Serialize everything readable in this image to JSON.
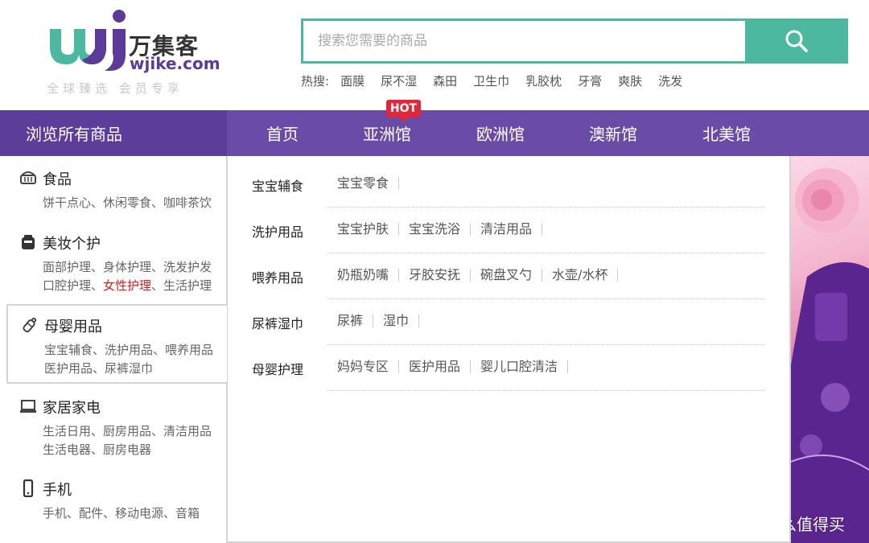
{
  "logo": {
    "name_cn": "万集客",
    "domain": "wjike.com",
    "slogan": "全球臻选 会员专享"
  },
  "search": {
    "placeholder": "搜索您需要的商品",
    "value": ""
  },
  "hot": {
    "label": "热搜:",
    "words": [
      "面膜",
      "尿不湿",
      "森田",
      "卫生巾",
      "乳胶枕",
      "牙膏",
      "爽肤",
      "洗发"
    ]
  },
  "nav": {
    "browse_all": "浏览所有商品",
    "items": [
      "首页",
      "亚洲馆",
      "欧洲馆",
      "澳新馆",
      "北美馆"
    ],
    "hot_badge": "HOT"
  },
  "categories": [
    {
      "title": "食品",
      "icon": "basket-icon",
      "lines": [
        [
          "饼干点心、休闲零食、咖啡茶饮"
        ]
      ]
    },
    {
      "title": "美妆个护",
      "icon": "makeup-icon",
      "lines": [
        [
          "面部护理、身体护理、洗发护发"
        ],
        [
          "口腔护理、",
          "女性护理",
          "、生活护理"
        ]
      ]
    },
    {
      "title": "母婴用品",
      "icon": "baby-bottle-icon",
      "lines": [
        [
          "宝宝辅食、洗护用品、喂养用品"
        ],
        [
          "医护用品、尿裤湿巾"
        ]
      ],
      "active": true
    },
    {
      "title": "家居家电",
      "icon": "laptop-icon",
      "lines": [
        [
          "生活日用、厨房用品、清洁用品"
        ],
        [
          "生活电器、厨房电器"
        ]
      ]
    },
    {
      "title": "手机",
      "icon": "mobile-phone-icon",
      "lines": [
        [
          "手机、配件、移动电源、音箱"
        ]
      ]
    }
  ],
  "subcategories": [
    {
      "title": "宝宝辅食",
      "items": [
        "宝宝零食"
      ]
    },
    {
      "title": "洗护用品",
      "items": [
        "宝宝护肤",
        "宝宝洗浴",
        "清洁用品"
      ]
    },
    {
      "title": "喂养用品",
      "items": [
        "奶瓶奶嘴",
        "牙胶安抚",
        "碗盘叉勺",
        "水壶/水杯"
      ]
    },
    {
      "title": "尿裤湿巾",
      "items": [
        "尿裤",
        "湿巾"
      ]
    },
    {
      "title": "母婴护理",
      "items": [
        "妈妈专区",
        "医护用品",
        "婴儿口腔清洁"
      ]
    }
  ],
  "watermark": {
    "text": "什么值得买",
    "mark": "值"
  },
  "colors": {
    "teal": "#4db8a0",
    "purple_nav": "#6a4ba6",
    "purple_browse": "#5c3d99",
    "hot_red": "#e0283a",
    "highlight_red": "#d81e1e"
  }
}
